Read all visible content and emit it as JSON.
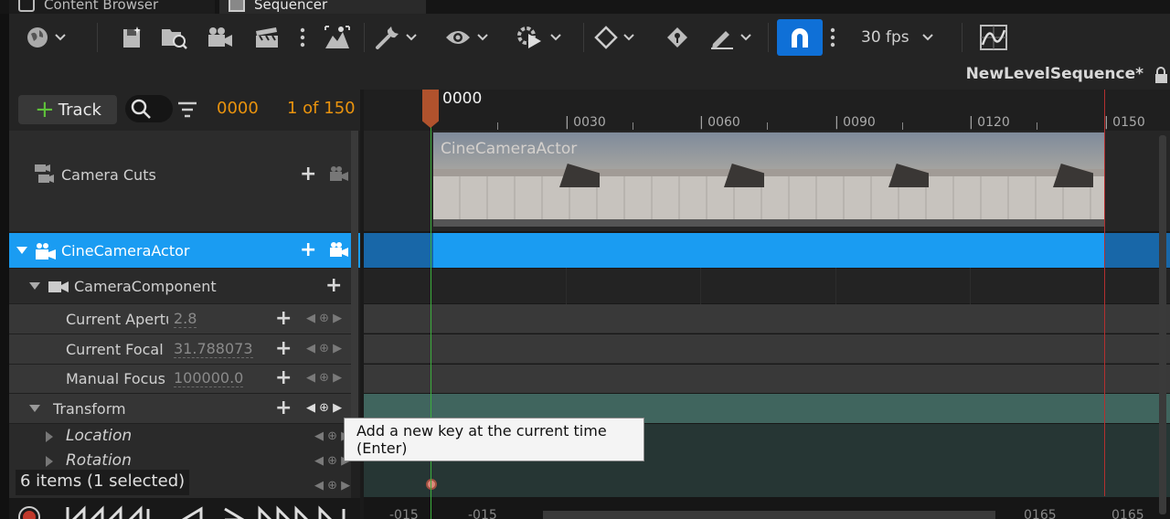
{
  "tabs": [
    {
      "label": "Content Browser"
    },
    {
      "label": "Sequencer"
    }
  ],
  "toolbar": {
    "fps_label": "30 fps",
    "icons": [
      "globe-icon",
      "save-icon",
      "browse-icon",
      "camera-icon",
      "clapper-icon",
      "more-icon",
      "render-icon",
      "tools-icon",
      "eye-icon",
      "gear-play-icon",
      "key-icon",
      "key-tag-icon",
      "pencil-icon",
      "magnet-icon",
      "curve-icon"
    ],
    "snap_color": "#0f70d7"
  },
  "sequence_name": "NewLevelSequence*",
  "outliner": {
    "add_track_label": "Track",
    "current_frame": "0000",
    "frame_range": "1 of 150",
    "rows": [
      {
        "label": "Camera Cuts"
      },
      {
        "label": "CineCameraActor"
      },
      {
        "label": "CameraComponent"
      },
      {
        "label": "Current Aperture",
        "value": "2.8"
      },
      {
        "label": "Current Focal Length",
        "value": "31.788073"
      },
      {
        "label": "Manual Focus",
        "value": "100000.0"
      },
      {
        "label": "Transform"
      },
      {
        "label": "Location"
      },
      {
        "label": "Rotation"
      }
    ],
    "item_count": "6 items (1 selected)"
  },
  "timeline": {
    "playhead_label": "0000",
    "ticks": [
      "| 0030",
      "| 0060",
      "| 0090",
      "| 0120",
      "| 0150"
    ],
    "shot_label": "CineCameraActor",
    "bottom_ticks": [
      "-015",
      "-015",
      "0165",
      "0165"
    ],
    "selected_color": "#1a9cf2",
    "transform_color": "#40655e"
  },
  "tooltip": "Add a new key at the current time (Enter)"
}
